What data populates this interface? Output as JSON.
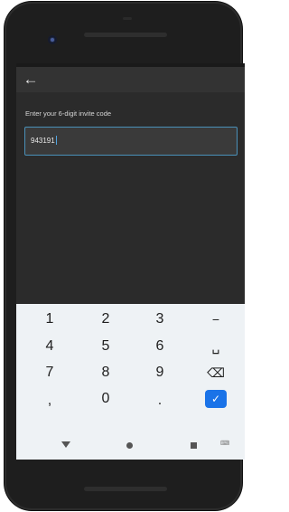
{
  "screen": {
    "back_icon": "arrow-left-icon",
    "prompt": "Enter your 6-digit invite code",
    "code_value": "943191"
  },
  "keyboard": {
    "rows": [
      [
        "1",
        "2",
        "3",
        "−"
      ],
      [
        "4",
        "5",
        "6",
        "␣"
      ],
      [
        "7",
        "8",
        "9",
        "⌫"
      ],
      [
        ",",
        "0",
        ".",
        "✓"
      ]
    ]
  },
  "nav": {
    "back_icon": "nav-back-triangle-icon",
    "home_icon": "nav-home-circle-icon",
    "recents_icon": "nav-recents-square-icon",
    "keyboard_icon": "keyboard-switch-icon"
  },
  "colors": {
    "accent": "#1a73e8",
    "input_border": "#4a90b8",
    "screen_bg": "#2b2b2b"
  }
}
